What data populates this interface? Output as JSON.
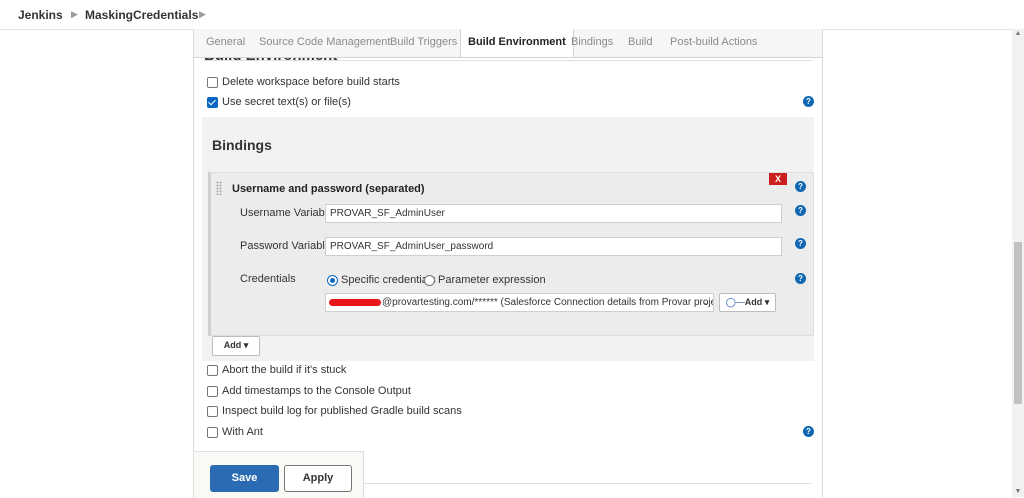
{
  "breadcrumb": {
    "items": [
      "Jenkins",
      "MaskingCredentials"
    ]
  },
  "tabs": [
    {
      "label": "General"
    },
    {
      "label": "Source Code Management"
    },
    {
      "label": "Build Triggers"
    },
    {
      "label": "Build Environment",
      "active": true
    },
    {
      "label": "Bindings"
    },
    {
      "label": "Build"
    },
    {
      "label": "Post-build Actions"
    }
  ],
  "section": {
    "title_cut": "Build Environment",
    "next_cut": "B"
  },
  "options_top": [
    {
      "label": "Delete workspace before build starts",
      "checked": false
    },
    {
      "label": "Use secret text(s) or file(s)",
      "checked": true
    }
  ],
  "bindings": {
    "title": "Bindings",
    "binding": {
      "header": "Username and password (separated)",
      "delete_label": "X",
      "username_label": "Username Variable",
      "username_value": "PROVAR_SF_AdminUser",
      "password_label": "Password Variable",
      "password_value": "PROVAR_SF_AdminUser_password",
      "credentials_label": "Credentials",
      "radio_specific": "Specific credentials",
      "radio_parameter": "Parameter expression",
      "credential_selected": "@provartesting.com/****** (Salesforce Connection details from Provar projec",
      "add_credential_label": "Add"
    },
    "add_label": "Add"
  },
  "options_bottom": [
    {
      "label": "Abort the build if it's stuck",
      "checked": false
    },
    {
      "label": "Add timestamps to the Console Output",
      "checked": false
    },
    {
      "label": "Inspect build log for published Gradle build scans",
      "checked": false
    },
    {
      "label": "With Ant",
      "checked": false
    }
  ],
  "actions": {
    "save": "Save",
    "apply": "Apply"
  },
  "help_glyph": "?",
  "colors": {
    "accent": "#2a6bb3",
    "help": "#0f67b1",
    "delete": "#cc1f1f",
    "redaction": "#e8151b"
  }
}
